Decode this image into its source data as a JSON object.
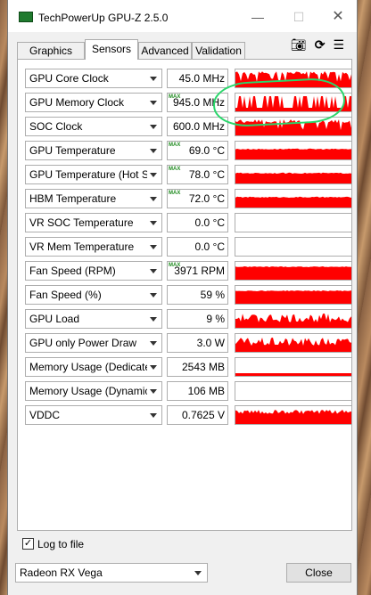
{
  "window": {
    "title": "TechPowerUp GPU-Z 2.5.0",
    "minimize": "—",
    "maximize": "☐",
    "close": "✕"
  },
  "tabs": [
    {
      "label": "Graphics Card",
      "active": false
    },
    {
      "label": "Sensors",
      "active": true
    },
    {
      "label": "Advanced",
      "active": false
    },
    {
      "label": "Validation",
      "active": false
    }
  ],
  "toolbar": {
    "camera_icon": "camera-icon",
    "refresh_icon": "refresh-icon",
    "menu_icon": "hamburger-menu-icon"
  },
  "graph_color": "#ff0000",
  "sensors": [
    {
      "name": "GPU Core Clock",
      "value": "45.0 MHz",
      "max": "",
      "graph": "spiky-high"
    },
    {
      "name": "GPU Memory Clock",
      "value": "945.0 MHz",
      "max": "MAX",
      "graph": "comb"
    },
    {
      "name": "SOC Clock",
      "value": "600.0 MHz",
      "max": "",
      "graph": "spiky-high"
    },
    {
      "name": "GPU Temperature",
      "value": "69.0 °C",
      "max": "MAX",
      "graph": "flat-mid"
    },
    {
      "name": "GPU Temperature (Hot Spot)",
      "value": "78.0 °C",
      "max": "MAX",
      "graph": "flat-mid"
    },
    {
      "name": "HBM Temperature",
      "value": "72.0 °C",
      "max": "MAX",
      "graph": "flat-mid"
    },
    {
      "name": "VR SOC Temperature",
      "value": "0.0 °C",
      "max": "",
      "graph": "empty"
    },
    {
      "name": "VR Mem Temperature",
      "value": "0.0 °C",
      "max": "",
      "graph": "empty"
    },
    {
      "name": "Fan Speed (RPM)",
      "value": "3971 RPM",
      "max": "MAX",
      "graph": "flat-high"
    },
    {
      "name": "Fan Speed (%)",
      "value": "59 %",
      "max": "",
      "graph": "flat-high"
    },
    {
      "name": "GPU Load",
      "value": "9 %",
      "max": "",
      "graph": "noisy"
    },
    {
      "name": "GPU only Power Draw",
      "value": "3.0 W",
      "max": "",
      "graph": "noisy"
    },
    {
      "name": "Memory Usage (Dedicated)",
      "value": "2543 MB",
      "max": "",
      "graph": "low-flat"
    },
    {
      "name": "Memory Usage (Dynamic)",
      "value": "106 MB",
      "max": "",
      "graph": "empty"
    },
    {
      "name": "VDDC",
      "value": "0.7625 V",
      "max": "",
      "graph": "noisy-mid"
    }
  ],
  "footer": {
    "log_to_file": "Log to file",
    "log_checked": true,
    "device": "Radeon RX Vega",
    "close_label": "Close"
  }
}
